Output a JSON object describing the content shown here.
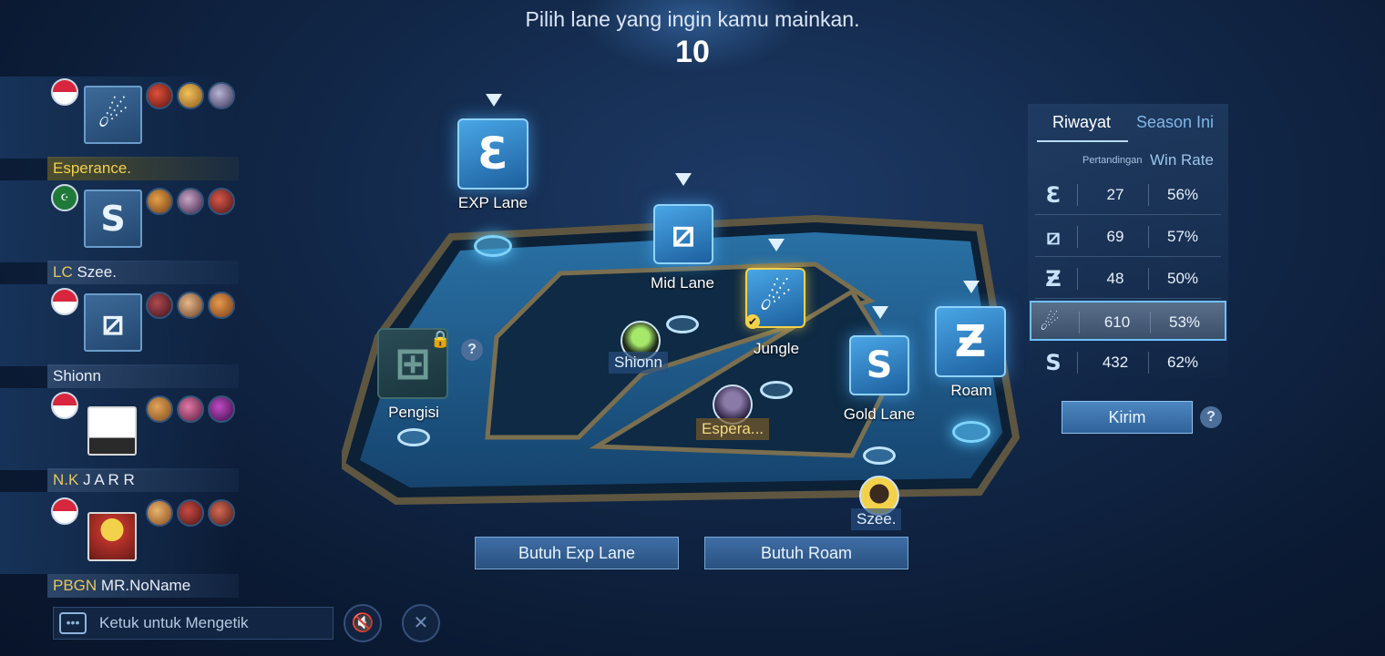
{
  "header": {
    "prompt": "Pilih lane yang ingin kamu mainkan.",
    "countdown": "10"
  },
  "players": [
    {
      "flag": "indonesia",
      "role_icon": "jungle-icon",
      "name_tag": "",
      "name": "Esperance.",
      "is_self": true
    },
    {
      "flag": "saudi-arabia",
      "role_icon": "gold-lane-icon",
      "name_tag": "LC",
      "name": "Szee.",
      "is_self": false
    },
    {
      "flag": "indonesia",
      "role_icon": "mid-lane-icon",
      "name_tag": "",
      "name": "Shionn",
      "is_self": false
    },
    {
      "flag": "indonesia",
      "role_icon": "avatar-icon",
      "name_tag": "N.K",
      "name": "J A R R",
      "is_self": false
    },
    {
      "flag": "indonesia",
      "role_icon": "avatar-icon",
      "name_tag": "PBGN",
      "name": "MR.NoName",
      "is_self": false
    }
  ],
  "lanes": {
    "exp": {
      "label": "EXP Lane",
      "icon": "exp-lane-icon"
    },
    "mid": {
      "label": "Mid Lane",
      "icon": "mid-lane-icon"
    },
    "jungle": {
      "label": "Jungle",
      "icon": "jungle-icon"
    },
    "gold": {
      "label": "Gold Lane",
      "icon": "gold-lane-icon"
    },
    "roam": {
      "label": "Roam",
      "icon": "roam-icon"
    },
    "filler": {
      "label": "Pengisi",
      "icon": "filler-icon",
      "locked": true
    }
  },
  "map_players": {
    "mid": "Shionn",
    "jungle": "Espera...",
    "gold": "Szee."
  },
  "buttons": {
    "need_exp": "Butuh Exp Lane",
    "need_roam": "Butuh Roam",
    "send": "Kirim",
    "help": "?"
  },
  "stats": {
    "tabs": [
      "Riwayat",
      "Season Ini"
    ],
    "col_matches": "Pertandingan",
    "col_winrate": "Win Rate",
    "rows": [
      {
        "lane_icon": "exp-lane-icon",
        "matches": "27",
        "winrate": "56%"
      },
      {
        "lane_icon": "mid-lane-icon",
        "matches": "69",
        "winrate": "57%"
      },
      {
        "lane_icon": "roam-icon",
        "matches": "48",
        "winrate": "50%"
      },
      {
        "lane_icon": "jungle-icon",
        "matches": "610",
        "winrate": "53%",
        "selected": true
      },
      {
        "lane_icon": "gold-lane-icon",
        "matches": "432",
        "winrate": "62%"
      }
    ]
  },
  "chat": {
    "placeholder": "Ketuk untuk Mengetik"
  },
  "colors": {
    "accent": "#5ac8ff",
    "self_name": "#f2d24a",
    "background": "#122849"
  }
}
